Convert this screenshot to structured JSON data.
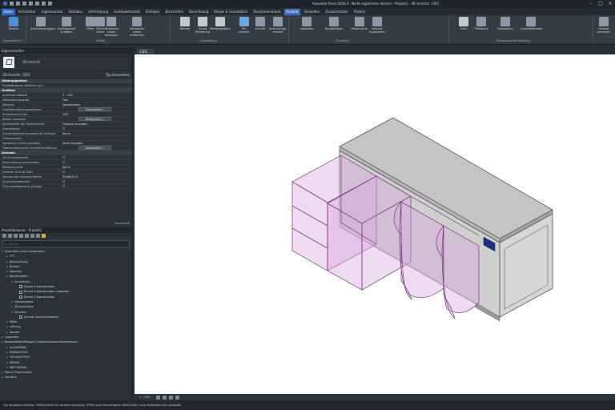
{
  "window": {
    "title": "Autodesk Revit 2026.4 - Nicht registrierte Version - Projekt1 - 3D-Ansicht: {3D}"
  },
  "ribbon_tabs": [
    "Datei",
    "Architektur",
    "Ingenieurbau",
    "Stahlbau",
    "Vorfertigung",
    "Gebäudetechnik",
    "Einfügen",
    "Beschriften",
    "Berechnung",
    "Körper & Grundstück",
    "Zusammenarbeit",
    "Ansicht",
    "Verwalten",
    "Zusatzmodule",
    "Ändern"
  ],
  "ribbon_active_tab": "Ansicht",
  "ribbon": {
    "buttons": [
      {
        "label": "Ändern",
        "color": "#4b8fd6"
      },
      {
        "label": "Ansichtsvorlagen",
        "color": "#8d97a6"
      },
      {
        "label": "Sichtbarkeit/\nGrafiken",
        "color": "#8d97a6"
      },
      {
        "label": "Filter",
        "color": "#8d97a6"
      },
      {
        "label": "Feine\nLinien",
        "color": "#8d97a6"
      },
      {
        "label": "Verdeckte Linien\nanzeigen",
        "color": "#8d97a6"
      },
      {
        "label": "Verdeckte Linien\nentfernen",
        "color": "#8d97a6"
      },
      {
        "label": "Render",
        "color": "#c0c7d1"
      },
      {
        "label": "Cloud\nRendering",
        "color": "#c0c7d1"
      },
      {
        "label": "Rendergalerie",
        "color": "#c0c7d1"
      },
      {
        "label": "3D-\nAnsicht",
        "color": "#6fa8e0"
      },
      {
        "label": "Schnitt",
        "color": "#8d97a6"
      },
      {
        "label": "Zeichnungs-\nansicht",
        "color": "#8d97a6"
      },
      {
        "label": "Legenden",
        "color": "#8d97a6"
      },
      {
        "label": "Bauteillisten",
        "color": "#8d97a6"
      },
      {
        "label": "Planansicht",
        "color": "#8d97a6"
      },
      {
        "label": "Ansicht\nduplizieren",
        "color": "#8d97a6"
      },
      {
        "label": "Plan",
        "color": "#c0c7d1"
      },
      {
        "label": "Titelblock",
        "color": "#8d97a6"
      },
      {
        "label": "Revisionen",
        "color": "#8d97a6"
      },
      {
        "label": "Ansichtsfenster",
        "color": "#8d97a6"
      },
      {
        "label": "Fenster\nwechseln",
        "color": "#8d97a6"
      }
    ],
    "groups": [
      "Auswählen ▾",
      "Grafik",
      "Darstellung",
      "Erstellen",
      "Planzusammenstellung"
    ]
  },
  "properties": {
    "title": "Eigenschaften",
    "type_name": "3D-Ansicht",
    "selector": "3D-Ansicht: {3D}",
    "edit_type": "Typ bearbeiten",
    "rows": [
      {
        "k": "Abhängigkeiten",
        "v": "",
        "cat": true
      },
      {
        "k": "Projektbrowser (Bedarf ing 1",
        "v": ""
      },
      {
        "k": "Grafiken",
        "v": "",
        "cat": true
      },
      {
        "k": "Ansichtsmaßstab",
        "v": "1 : 100"
      },
      {
        "k": "Detaillierungsgrad",
        "v": "Fein"
      },
      {
        "k": "Disziplin",
        "v": "Koordination"
      },
      {
        "k": "Grafikdarstellungsoptionen",
        "v": "Bearbeiten...",
        "btn": true
      },
      {
        "k": "Skalierbare Linie...",
        "v": "100"
      },
      {
        "k": "Raster anzeigen",
        "v": "Bearbeiten...",
        "btn": true
      },
      {
        "k": "Sichtbarkeit der Teilelemente",
        "v": "Original anzeigen"
      },
      {
        "k": "Szenenbahn",
        "v": "☐",
        "chk": true
      },
      {
        "k": "Standardberechnungsart für Analyse",
        "v": "Keine"
      },
      {
        "k": "Unterdisziplin",
        "v": ""
      },
      {
        "k": "Verdeckte Linien anzeigen",
        "v": "Nach Disziplin"
      },
      {
        "k": "Überschreibungen Schattenauflösung",
        "v": "Bearbeiten...",
        "btn": true
      },
      {
        "k": "Grenzen",
        "v": "",
        "cat": true
      },
      {
        "k": "3D-Schnittbereich",
        "v": "☐",
        "chk": true
      },
      {
        "k": "Beschriftung zuschneiden",
        "v": "☐",
        "chk": true
      },
      {
        "k": "Bildausschnitt",
        "v": "Keine"
      },
      {
        "k": "Hinterer Schnitt aktiv",
        "v": "☐",
        "chk": true
      },
      {
        "k": "Versatz der hinteren Ebene",
        "v": "3048810.0"
      },
      {
        "k": "Zuschneidebereich",
        "v": "☐",
        "chk": true
      },
      {
        "k": "Zuschneidebereich sichtbar",
        "v": "☐",
        "chk": true
      }
    ],
    "apply": "Anwenden"
  },
  "project_browser": {
    "title": "Projektbrowser - Projekt1",
    "search_placeholder": "Suchen",
    "items": [
      {
        "indent": 0,
        "tw": "▾",
        "label": "Ansichten (nach Gewerken)"
      },
      {
        "indent": 1,
        "tw": "▸",
        "label": "???"
      },
      {
        "indent": 1,
        "tw": "▸",
        "label": "Beleuchtung"
      },
      {
        "indent": 1,
        "tw": "▸",
        "label": "Elektro"
      },
      {
        "indent": 1,
        "tw": "▸",
        "label": "Heizung"
      },
      {
        "indent": 1,
        "tw": "▾",
        "label": "Koordination"
      },
      {
        "indent": 2,
        "tw": "▾",
        "label": "Grundrisse"
      },
      {
        "indent": 3,
        "tw": "",
        "label": "Ebene 0 Koordination",
        "sq": true
      },
      {
        "indent": 3,
        "tw": "",
        "label": "Ebene 0 Koordination Lageplan",
        "sq": true
      },
      {
        "indent": 3,
        "tw": "",
        "label": "Ebene 1 Koordination",
        "sq": true
      },
      {
        "indent": 2,
        "tw": "▸",
        "label": "Deckenpläne"
      },
      {
        "indent": 2,
        "tw": "▸",
        "label": "3D-Ansichten"
      },
      {
        "indent": 2,
        "tw": "▾",
        "label": "Schnitte"
      },
      {
        "indent": 3,
        "tw": "",
        "label": "Schnitt Übersichtsdetail",
        "sq": true
      },
      {
        "indent": 1,
        "tw": "▸",
        "label": "Kälte"
      },
      {
        "indent": 1,
        "tw": "▸",
        "label": "Lüftung"
      },
      {
        "indent": 1,
        "tw": "▸",
        "label": "Sanitär"
      },
      {
        "indent": 0,
        "tw": "▸",
        "label": "Legenden"
      },
      {
        "indent": 0,
        "tw": "▾",
        "label": "Bauteillisten/Mengen (Projektbrowser Bedarfsweg)"
      },
      {
        "indent": 1,
        "tw": "▸",
        "label": "ALLGEMEIN"
      },
      {
        "indent": 1,
        "tw": "▸",
        "label": "EINBAUTEILE"
      },
      {
        "indent": 1,
        "tw": "▸",
        "label": "HLS BAUTEILE"
      },
      {
        "indent": 1,
        "tw": "▸",
        "label": "KREISE"
      },
      {
        "indent": 1,
        "tw": "▸",
        "label": "MEP RÄUME"
      },
      {
        "indent": 0,
        "tw": "▸",
        "label": "Pläne (Planinhalte)"
      },
      {
        "indent": 0,
        "tw": "▸",
        "label": "Familien"
      }
    ]
  },
  "view_tab": "{3D}",
  "view_bar": {
    "scale": "1 : 100"
  },
  "status_bar": "Zur Auswahl klicken; TABULATOR für andere Auswahl; STRG zum Hinzufügen; UMSCHALT zum Aufheben der Auswahl"
}
